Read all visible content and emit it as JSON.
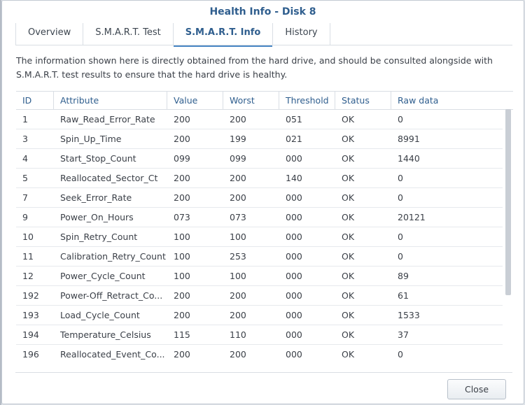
{
  "window": {
    "title": "Health Info - Disk 8"
  },
  "tabs": [
    {
      "label": "Overview",
      "active": false
    },
    {
      "label": "S.M.A.R.T. Test",
      "active": false
    },
    {
      "label": "S.M.A.R.T. Info",
      "active": true
    },
    {
      "label": "History",
      "active": false
    }
  ],
  "description": "The information shown here is directly obtained from the hard drive, and should be consulted alongside with S.M.A.R.T. test results to ensure that the hard drive is healthy.",
  "table": {
    "columns": [
      "ID",
      "Attribute",
      "Value",
      "Worst",
      "Threshold",
      "Status",
      "Raw data"
    ],
    "rows": [
      [
        "1",
        "Raw_Read_Error_Rate",
        "200",
        "200",
        "051",
        "OK",
        "0"
      ],
      [
        "3",
        "Spin_Up_Time",
        "200",
        "199",
        "021",
        "OK",
        "8991"
      ],
      [
        "4",
        "Start_Stop_Count",
        "099",
        "099",
        "000",
        "OK",
        "1440"
      ],
      [
        "5",
        "Reallocated_Sector_Ct",
        "200",
        "200",
        "140",
        "OK",
        "0"
      ],
      [
        "7",
        "Seek_Error_Rate",
        "200",
        "200",
        "000",
        "OK",
        "0"
      ],
      [
        "9",
        "Power_On_Hours",
        "073",
        "073",
        "000",
        "OK",
        "20121"
      ],
      [
        "10",
        "Spin_Retry_Count",
        "100",
        "100",
        "000",
        "OK",
        "0"
      ],
      [
        "11",
        "Calibration_Retry_Count",
        "100",
        "253",
        "000",
        "OK",
        "0"
      ],
      [
        "12",
        "Power_Cycle_Count",
        "100",
        "100",
        "000",
        "OK",
        "89"
      ],
      [
        "192",
        "Power-Off_Retract_Co...",
        "200",
        "200",
        "000",
        "OK",
        "61"
      ],
      [
        "193",
        "Load_Cycle_Count",
        "200",
        "200",
        "000",
        "OK",
        "1533"
      ],
      [
        "194",
        "Temperature_Celsius",
        "115",
        "110",
        "000",
        "OK",
        "37"
      ],
      [
        "196",
        "Reallocated_Event_Co...",
        "200",
        "200",
        "000",
        "OK",
        "0"
      ]
    ]
  },
  "footer": {
    "close_label": "Close"
  }
}
